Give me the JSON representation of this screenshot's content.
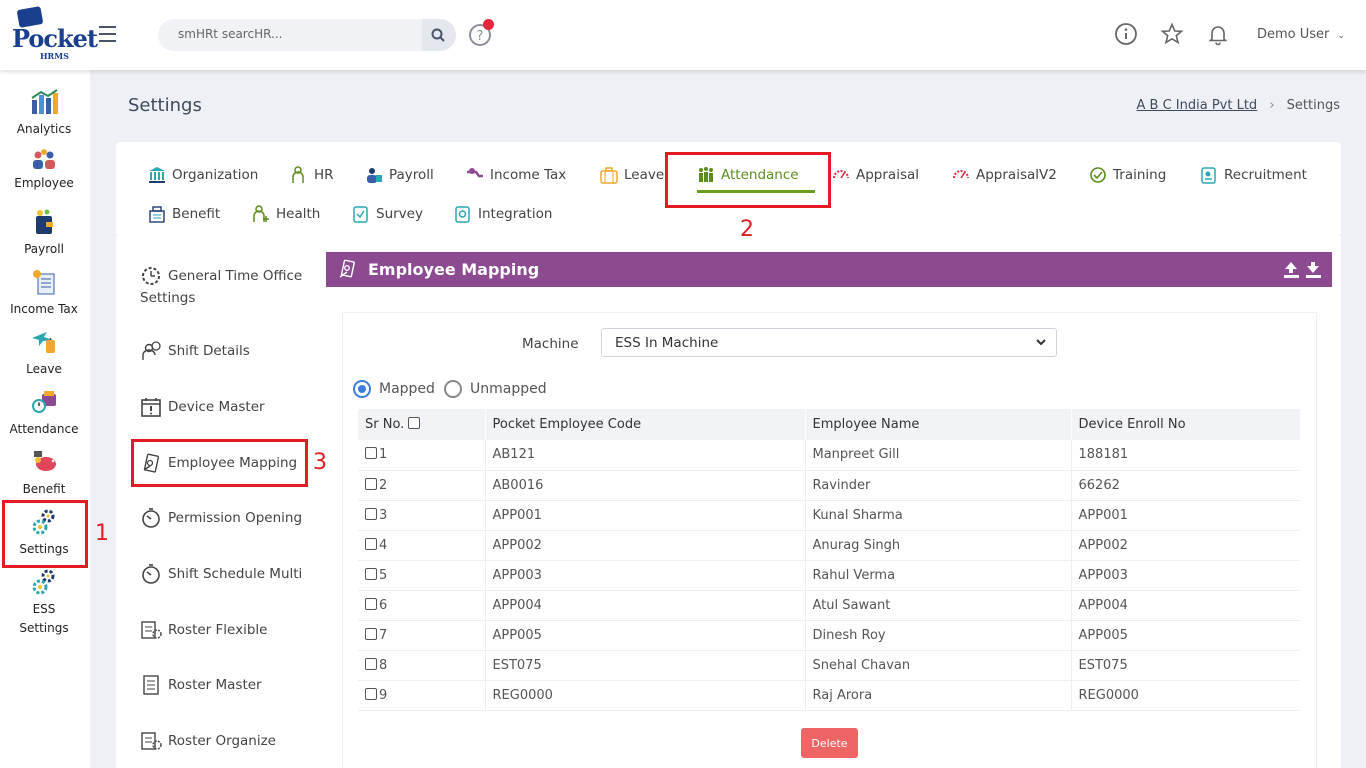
{
  "header": {
    "logo_word": "Pocket",
    "logo_sub": "HRMS",
    "search_placeholder": "smHRt searcHR...",
    "user_name": "Demo User"
  },
  "sidebar": {
    "items": [
      {
        "label": "Analytics"
      },
      {
        "label": "Employee"
      },
      {
        "label": "Payroll"
      },
      {
        "label": "Income Tax"
      },
      {
        "label": "Leave"
      },
      {
        "label": "Attendance"
      },
      {
        "label": "Benefit"
      },
      {
        "label": "Settings"
      },
      {
        "label": "ESS"
      },
      {
        "label": "Settings"
      }
    ]
  },
  "page": {
    "title": "Settings",
    "breadcrumb_company": "A B C India Pvt Ltd",
    "breadcrumb_current": "Settings"
  },
  "tabs": [
    {
      "label": "Organization"
    },
    {
      "label": "HR"
    },
    {
      "label": "Payroll"
    },
    {
      "label": "Income Tax"
    },
    {
      "label": "Leave"
    },
    {
      "label": "Attendance"
    },
    {
      "label": "Appraisal"
    },
    {
      "label": "AppraisalV2"
    },
    {
      "label": "Training"
    },
    {
      "label": "Recruitment"
    },
    {
      "label": "Benefit"
    },
    {
      "label": "Health"
    },
    {
      "label": "Survey"
    },
    {
      "label": "Integration"
    }
  ],
  "submenu": [
    {
      "label": "General Time Office"
    },
    {
      "label": "Settings"
    },
    {
      "label": "Shift Details"
    },
    {
      "label": "Device Master"
    },
    {
      "label": "Employee Mapping"
    },
    {
      "label": "Permission Opening"
    },
    {
      "label": "Shift Schedule Multi"
    },
    {
      "label": "Roster Flexible"
    },
    {
      "label": "Roster Master"
    },
    {
      "label": "Roster Organize"
    }
  ],
  "panel": {
    "title": "Employee Mapping",
    "machine_label": "Machine",
    "machine_value": "ESS In Machine",
    "radio_mapped": "Mapped",
    "radio_unmapped": "Unmapped",
    "delete_label": "Delete"
  },
  "table": {
    "headers": [
      "Sr No.",
      "Pocket Employee Code",
      "Employee Name",
      "Device Enroll No"
    ],
    "rows": [
      {
        "sr": "1",
        "code": "AB121",
        "name": "Manpreet Gill",
        "enroll": "188181"
      },
      {
        "sr": "2",
        "code": "AB0016",
        "name": "Ravinder",
        "enroll": "66262"
      },
      {
        "sr": "3",
        "code": "APP001",
        "name": "Kunal Sharma",
        "enroll": "APP001"
      },
      {
        "sr": "4",
        "code": "APP002",
        "name": "Anurag Singh",
        "enroll": "APP002"
      },
      {
        "sr": "5",
        "code": "APP003",
        "name": "Rahul Verma",
        "enroll": "APP003"
      },
      {
        "sr": "6",
        "code": "APP004",
        "name": "Atul Sawant",
        "enroll": "APP004"
      },
      {
        "sr": "7",
        "code": "APP005",
        "name": "Dinesh Roy",
        "enroll": "APP005"
      },
      {
        "sr": "8",
        "code": "EST075",
        "name": "Snehal Chavan",
        "enroll": "EST075"
      },
      {
        "sr": "9",
        "code": "REG0000",
        "name": "Raj Arora",
        "enroll": "REG0000"
      }
    ]
  },
  "annotations": [
    "1",
    "2",
    "3"
  ],
  "colors": {
    "panel_header": "#8c4a91",
    "active_tab": "#5d8c1e",
    "annotation": "#e31c23",
    "delete_button": "#ef6565",
    "radio_selected": "#3b7ddd"
  }
}
